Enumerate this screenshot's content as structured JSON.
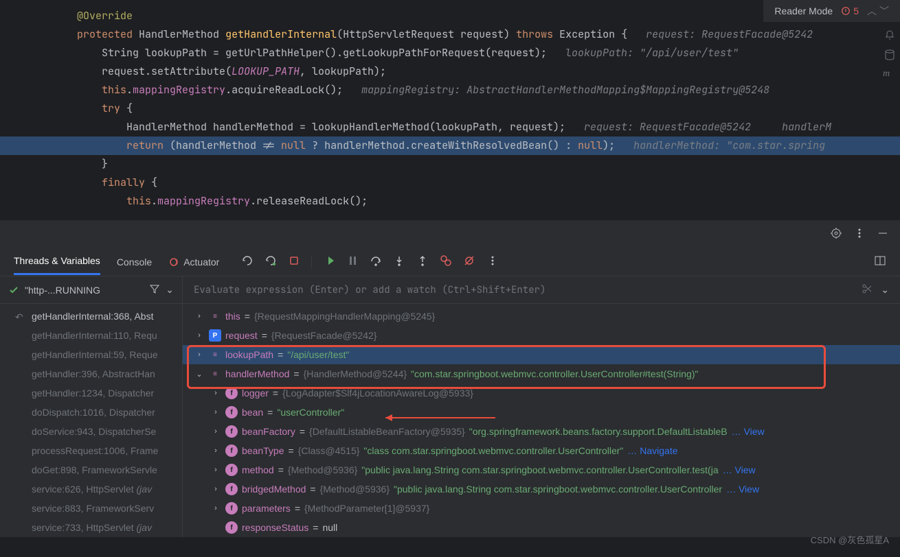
{
  "editorTop": {
    "readerMode": "Reader Mode",
    "errorCount": "5"
  },
  "code": {
    "l1_ann": "@Override",
    "l2_kw1": "protected",
    "l2_type": "HandlerMethod ",
    "l2_fn": "getHandlerInternal",
    "l2_sig": "(HttpServletRequest request) ",
    "l2_kw2": "throws",
    "l2_exc": " Exception {",
    "l2_hint": "request: RequestFacade@5242",
    "l3_a": "String lookupPath = getUrlPathHelper().getLookupPathForRequest(request);",
    "l3_hint": "lookupPath: \"/api/user/test\"",
    "l4_a": "request.setAttribute(",
    "l4_const": "LOOKUP_PATH",
    "l4_b": ", lookupPath);",
    "l5_this": "this",
    "l5_dot": ".",
    "l5_field": "mappingRegistry",
    "l5_call": ".acquireReadLock();",
    "l5_hint": "mappingRegistry: AbstractHandlerMethodMapping$MappingRegistry@5248",
    "l6_kw": "try",
    "l6_b": " {",
    "l7_a": "HandlerMethod handlerMethod = lookupHandlerMethod(lookupPath, request);",
    "l7_hint1": "request: RequestFacade@5242",
    "l7_hint2": "handlerM",
    "l8_kw": "return",
    "l8_a": " (handlerMethod != ",
    "l8_n1": "null",
    "l8_b": " ? handlerMethod.createWithResolvedBean() : ",
    "l8_n2": "null",
    "l8_c": ");",
    "l8_hint": "handlerMethod: \"com.star.spring",
    "l9": "}",
    "l10_kw": "finally",
    "l10_b": " {",
    "l11_this": "this",
    "l11_dot": ".",
    "l11_field": "mappingRegistry",
    "l11_call": ".releaseReadLock();"
  },
  "tabs": {
    "threads": "Threads & Variables",
    "console": "Console",
    "actuator": "Actuator"
  },
  "threadHeader": "\"http-...RUNNING",
  "frames": [
    {
      "text": "getHandlerInternal:368, Abst",
      "cur": true,
      "back": true
    },
    {
      "text": "getHandlerInternal:110, Requ",
      "dim": true
    },
    {
      "text": "getHandlerInternal:59, Reque",
      "dim": true
    },
    {
      "text": "getHandler:396, AbstractHan",
      "dim": true
    },
    {
      "text": "getHandler:1234, Dispatcher",
      "dim": true
    },
    {
      "text": "doDispatch:1016, Dispatcher",
      "dim": true
    },
    {
      "text": "doService:943, DispatcherSe",
      "dim": true
    },
    {
      "text": "processRequest:1006, Frame",
      "dim": true
    },
    {
      "text": "doGet:898, FrameworkServle",
      "dim": true
    },
    {
      "text": "service:626, HttpServlet",
      "dim": true,
      "ital": " (jav"
    },
    {
      "text": "service:883, FrameworkServ",
      "dim": true
    },
    {
      "text": "service:733, HttpServlet",
      "dim": true,
      "ital": " (jav"
    }
  ],
  "watchPlaceholder": "Evaluate expression (Enter) or add a watch (Ctrl+Shift+Enter)",
  "vars": {
    "this": {
      "name": "this",
      "val": "{RequestMappingHandlerMapping@5245}"
    },
    "request": {
      "name": "request",
      "val": "{RequestFacade@5242}"
    },
    "lookupPath": {
      "name": "lookupPath",
      "val": "\"/api/user/test\""
    },
    "handlerMethod": {
      "name": "handlerMethod",
      "obj": "{HandlerMethod@5244}",
      "val": "\"com.star.springboot.webmvc.controller.UserController#test(String)\""
    },
    "logger": {
      "name": "logger",
      "val": "{LogAdapter$Slf4jLocationAwareLog@5933}"
    },
    "bean": {
      "name": "bean",
      "val": "\"userController\""
    },
    "beanFactory": {
      "name": "beanFactory",
      "obj": "{DefaultListableBeanFactory@5935}",
      "val": "\"org.springframework.beans.factory.support.DefaultListableB",
      "nav": "… View"
    },
    "beanType": {
      "name": "beanType",
      "obj": "{Class@4515}",
      "val": "\"class com.star.springboot.webmvc.controller.UserController\"",
      "nav": "… Navigate"
    },
    "method": {
      "name": "method",
      "obj": "{Method@5936}",
      "val": "\"public java.lang.String com.star.springboot.webmvc.controller.UserController.test(ja",
      "nav": "… View"
    },
    "bridgedMethod": {
      "name": "bridgedMethod",
      "obj": "{Method@5936}",
      "val": "\"public java.lang.String com.star.springboot.webmvc.controller.UserController",
      "nav": "… View"
    },
    "parameters": {
      "name": "parameters",
      "val": "{MethodParameter[1]@5937}"
    },
    "responseStatus": {
      "name": "responseStatus",
      "val": "null"
    }
  },
  "watermark": "CSDN @灰色孤星A"
}
